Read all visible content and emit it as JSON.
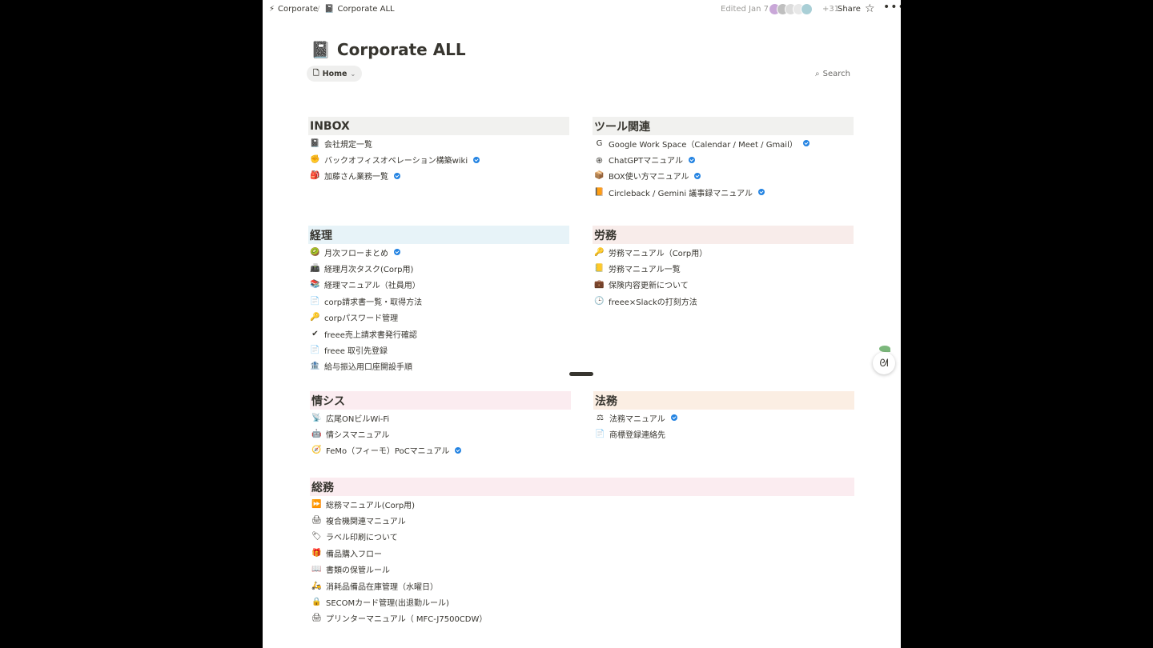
{
  "breadcrumb": {
    "workspace": "Corporate",
    "workspace_icon": "bolt-icon",
    "separator": "/",
    "page": "Corporate ALL",
    "page_icon": "notebook-icon"
  },
  "topbar": {
    "edited": "Edited Jan 7",
    "more_count": "+31",
    "share_label": "Share"
  },
  "title": "Corporate ALL",
  "home_chip": "Home",
  "search_label": "Search",
  "colors": {
    "inbox": "#f1f1ef",
    "tools": "#f1f1ef",
    "keiri": "#e7f3f8",
    "roumu": "#f8ecea",
    "joushisu": "#fbecf0",
    "houmu": "#fbeee3",
    "soumu": "#fbecf0",
    "verified": "#2383e2"
  },
  "sections": {
    "inbox": {
      "header": "INBOX",
      "items": [
        {
          "icon": "📓",
          "label": "会社規定一覧",
          "verified": false
        },
        {
          "icon": "✊",
          "label": "バックオフィスオペレーション構築wiki",
          "verified": true
        },
        {
          "icon": "🎒",
          "label": "加藤さん業務一覧",
          "verified": true
        }
      ]
    },
    "tools": {
      "header": "ツール関連",
      "items": [
        {
          "icon": "G",
          "label": "Google Work Space（Calendar / Meet / Gmail）",
          "verified": true
        },
        {
          "icon": "֎",
          "label": "ChatGPTマニュアル",
          "verified": true
        },
        {
          "icon": "📦",
          "label": "BOX使い方マニュアル",
          "verified": true
        },
        {
          "icon": "📙",
          "label": "Circleback / Gemini 議事録マニュアル",
          "verified": true
        }
      ]
    },
    "keiri": {
      "header": "経理",
      "items": [
        {
          "icon": "🥝",
          "label": "月次フローまとめ",
          "verified": true
        },
        {
          "icon": "📠",
          "label": "経理月次タスク(Corp用)",
          "verified": false
        },
        {
          "icon": "📚",
          "label": "経理マニュアル（社員用）",
          "verified": false
        },
        {
          "icon": "📄",
          "label": "corp請求書一覧・取得方法",
          "verified": false
        },
        {
          "icon": "🔑",
          "label": "corpパスワード管理",
          "verified": false
        },
        {
          "icon": "✔",
          "label": "freee売上請求書発行確認",
          "verified": false
        },
        {
          "icon": "📄",
          "label": "freee 取引先登録",
          "verified": false
        },
        {
          "icon": "🏦",
          "label": "給与振込用口座開設手順",
          "verified": false
        }
      ]
    },
    "roumu": {
      "header": "労務",
      "items": [
        {
          "icon": "🔑",
          "label": "労務マニュアル（Corp用）",
          "verified": false
        },
        {
          "icon": "📒",
          "label": "労務マニュアル一覧",
          "verified": false
        },
        {
          "icon": "💼",
          "label": "保険内容更新について",
          "verified": false
        },
        {
          "icon": "🕒",
          "label": "freee×Slackの打刻方法",
          "verified": false
        }
      ]
    },
    "joushisu": {
      "header": "情シス",
      "items": [
        {
          "icon": "📡",
          "label": "広尾ONビルWi-Fi",
          "verified": false
        },
        {
          "icon": "🤖",
          "label": "情シスマニュアル",
          "verified": false
        },
        {
          "icon": "🧭",
          "label": "FeMo（フィーモ）PoCマニュアル",
          "verified": true
        }
      ]
    },
    "houmu": {
      "header": "法務",
      "items": [
        {
          "icon": "⚖",
          "label": "法務マニュアル",
          "verified": true
        },
        {
          "icon": "📄",
          "label": "商標登録連絡先",
          "verified": false
        }
      ]
    },
    "soumu": {
      "header": "総務",
      "items": [
        {
          "icon": "⏩",
          "label": "総務マニュアル(Corp用)",
          "verified": false
        },
        {
          "icon": "🖨",
          "label": "複合機関連マニュアル",
          "verified": false
        },
        {
          "icon": "🏷",
          "label": "ラベル印刷について",
          "verified": false
        },
        {
          "icon": "🎁",
          "label": "備品購入フロー",
          "verified": false
        },
        {
          "icon": "📖",
          "label": "書類の保管ルール",
          "verified": false
        },
        {
          "icon": "🛵",
          "label": "消耗品備品在庫管理（水曜日）",
          "verified": false
        },
        {
          "icon": "🔒",
          "label": "SECOMカード管理(出退勤ルール)",
          "verified": false
        },
        {
          "icon": "🖨",
          "label": "プリンターマニュアル（ MFC-J7500CDW）",
          "verified": false
        }
      ]
    }
  }
}
